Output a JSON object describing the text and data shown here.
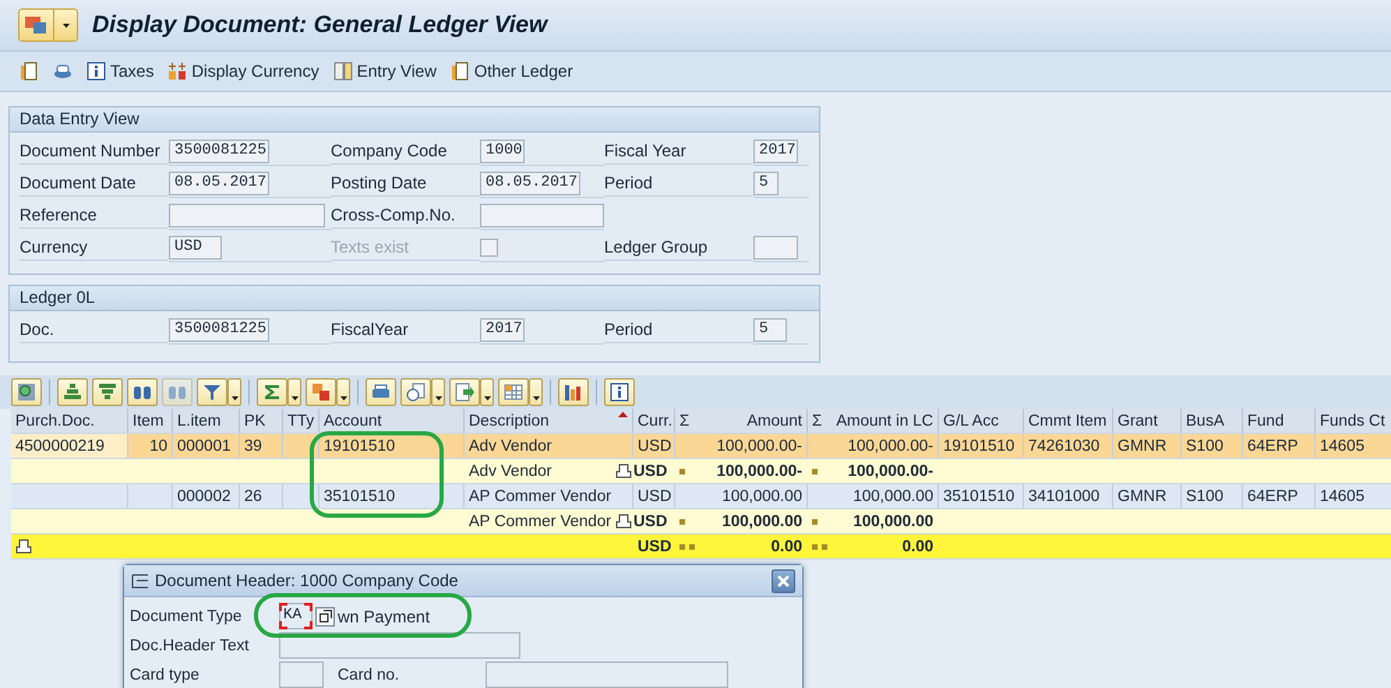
{
  "window": {
    "title": "Display Document: General Ledger View"
  },
  "toolbar": [
    {
      "label": "Taxes"
    },
    {
      "label": "Display Currency"
    },
    {
      "label": "Entry View"
    },
    {
      "label": "Other Ledger"
    }
  ],
  "data_entry_view": {
    "title": "Data Entry View",
    "rows": [
      [
        {
          "kind": "field",
          "label": "Document Number",
          "value": "3500081225"
        },
        {
          "kind": "field",
          "label": "Company Code",
          "value": "1000"
        },
        {
          "kind": "field",
          "label": "Fiscal Year",
          "value": "2017"
        }
      ],
      [
        {
          "kind": "field",
          "label": "Document Date",
          "value": "08.05.2017"
        },
        {
          "kind": "field",
          "label": "Posting Date",
          "value": "08.05.2017"
        },
        {
          "kind": "field",
          "label": "Period",
          "value": "5"
        }
      ],
      [
        {
          "kind": "field",
          "label": "Reference"
        },
        {
          "kind": "field",
          "label": "Cross-Comp.No."
        }
      ],
      [
        {
          "kind": "field",
          "label": "Currency",
          "value": "USD"
        },
        {
          "kind": "checkbox",
          "label": "Texts exist",
          "checked": false,
          "disabled": true
        },
        {
          "kind": "field",
          "label": "Ledger Group"
        }
      ]
    ]
  },
  "ledger": {
    "title": "Ledger 0L",
    "fields": [
      {
        "label": "Doc.",
        "value": "3500081225"
      },
      {
        "label": "FiscalYear",
        "value": "2017"
      },
      {
        "label": "Period",
        "value": "5"
      }
    ]
  },
  "table": {
    "columns": [
      {
        "label": "Purch.Doc.",
        "sorted": false
      },
      {
        "label": "Item",
        "sorted": false
      },
      {
        "label": "L.item",
        "sorted": false
      },
      {
        "label": "PK",
        "sorted": false
      },
      {
        "label": "TTy",
        "sorted": false
      },
      {
        "label": "Account",
        "sorted": false
      },
      {
        "label": "Description",
        "sorted": true
      },
      {
        "label": "Curr.",
        "sorted": false
      },
      {
        "label": "Amount",
        "sum_mark": "Σ",
        "sorted": false
      },
      {
        "label": "Amount in LC",
        "sum_mark": "Σ",
        "sorted": false
      },
      {
        "label": "G/L Acc",
        "sorted": false
      },
      {
        "label": "Cmmt Item",
        "sorted": false
      },
      {
        "label": "Grant",
        "sorted": false
      },
      {
        "label": "BusA",
        "sorted": false
      },
      {
        "label": "Fund",
        "sorted": false
      },
      {
        "label": "Funds Ct",
        "sorted": false
      }
    ],
    "rows": [
      {
        "kind": "item",
        "selected": true,
        "purch_doc": "4500000219",
        "item": "10",
        "l_item": "000001",
        "pk": "39",
        "account": "19101510",
        "description": "Adv Vendor",
        "curr": "USD",
        "amount": "100,000.00-",
        "amount_lc": "100,000.00-",
        "gl_acc": "19101510",
        "cmmt_item": "74261030",
        "grant": "GMNR",
        "busa": "S100",
        "fund": "64ERP",
        "funds_ct": "14605"
      },
      {
        "kind": "subtotal",
        "description": "Adv Vendor",
        "curr": "USD",
        "amount": "100,000.00-",
        "amount_lc": "100,000.00-"
      },
      {
        "kind": "item",
        "selected": false,
        "l_item": "000002",
        "pk": "26",
        "account": "35101510",
        "description": "AP Commer Vendor",
        "curr": "USD",
        "amount": "100,000.00",
        "amount_lc": "100,000.00",
        "gl_acc": "35101510",
        "cmmt_item": "34101000",
        "grant": "GMNR",
        "busa": "S100",
        "fund": "64ERP",
        "funds_ct": "14605"
      },
      {
        "kind": "subtotal",
        "description": "AP Commer Vendor",
        "curr": "USD",
        "amount": "100,000.00",
        "amount_lc": "100,000.00"
      },
      {
        "kind": "total",
        "curr": "USD",
        "amount": "0.00",
        "amount_lc": "0.00"
      }
    ]
  },
  "dialog": {
    "title": "Document Header: 1000 Company Code",
    "fields": [
      {
        "label": "Document Type",
        "value": "KA",
        "focused": true,
        "note": "wn Payment"
      },
      {
        "label": "Doc.Header Text"
      },
      {
        "label": "Card type",
        "second_label": "Card no."
      }
    ]
  }
}
